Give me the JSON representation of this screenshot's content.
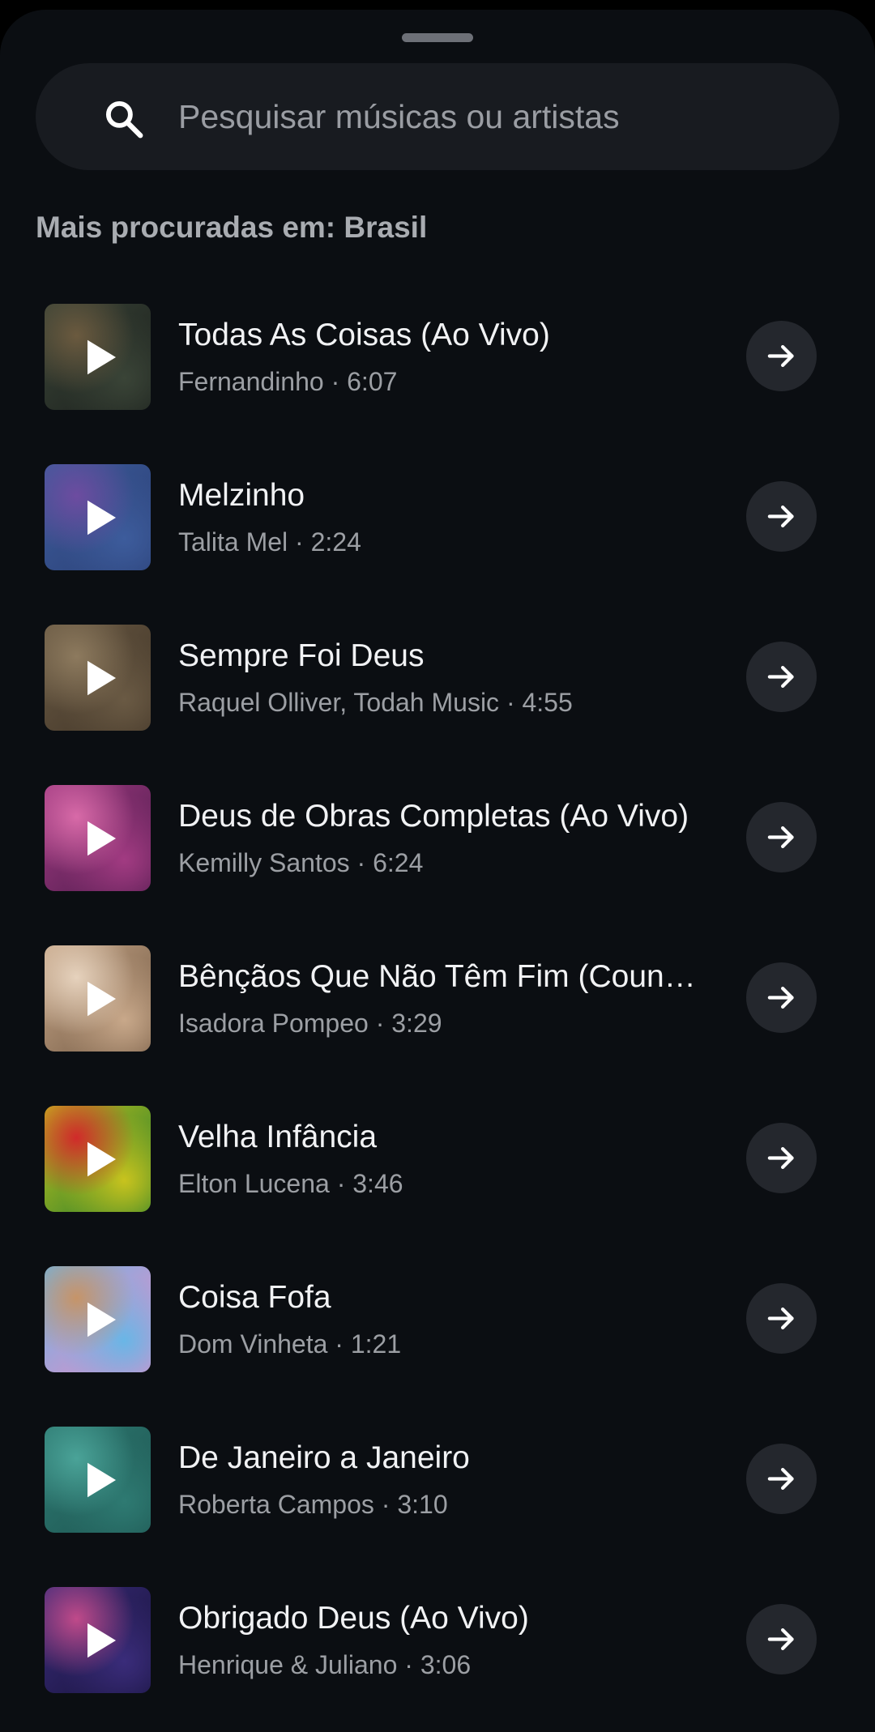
{
  "search": {
    "placeholder": "Pesquisar músicas ou artistas",
    "icon": "search-icon"
  },
  "section": {
    "title": "Mais procuradas em: Brasil"
  },
  "colors": {
    "background": "#0b0e12",
    "search_bg": "#181b20",
    "button_bg": "#24272d",
    "primary_text": "#f1f2f4",
    "secondary_text": "#9c9fa4"
  },
  "tracks": [
    {
      "title": "Todas As Coisas (Ao Vivo)",
      "subtitle": "Fernandinho · 6:07",
      "cover_colors": [
        "#3a4437",
        "#1a1f1c",
        "#6b5a3f"
      ],
      "play_icon": "play-icon",
      "action_icon": "arrow-right-icon"
    },
    {
      "title": "Melzinho",
      "subtitle": "Talita Mel · 2:24",
      "cover_colors": [
        "#3d5c9c",
        "#2a3f74",
        "#6d4ca0"
      ],
      "play_icon": "play-icon",
      "action_icon": "arrow-right-icon"
    },
    {
      "title": "Sempre Foi Deus",
      "subtitle": "Raquel Olliver, Todah Music · 4:55",
      "cover_colors": [
        "#6a5a44",
        "#3f3326",
        "#8d7a5e"
      ],
      "play_icon": "play-icon",
      "action_icon": "arrow-right-icon"
    },
    {
      "title": "Deus de Obras Completas (Ao Vivo)",
      "subtitle": "Kemilly Santos · 6:24",
      "cover_colors": [
        "#a23b82",
        "#4a1a4a",
        "#d86aa8"
      ],
      "play_icon": "play-icon",
      "action_icon": "arrow-right-icon"
    },
    {
      "title": "Bênçãos Que Não Têm Fim (Counting My Blessings)",
      "subtitle": "Isadora Pompeo · 3:29",
      "cover_colors": [
        "#c8a88a",
        "#6f5640",
        "#e6d2bd"
      ],
      "play_icon": "play-icon",
      "action_icon": "arrow-right-icon"
    },
    {
      "title": "Velha Infância",
      "subtitle": "Elton Lucena · 3:46",
      "cover_colors": [
        "#c8c31e",
        "#1c7a2c",
        "#d12a2a"
      ],
      "play_icon": "play-icon",
      "action_icon": "arrow-right-icon"
    },
    {
      "title": "Coisa Fofa",
      "subtitle": "Dom Vinheta · 1:21",
      "cover_colors": [
        "#69b6e6",
        "#e98bc6",
        "#c69468"
      ],
      "play_icon": "play-icon",
      "action_icon": "arrow-right-icon"
    },
    {
      "title": "De Janeiro a Janeiro",
      "subtitle": "Roberta Campos · 3:10",
      "cover_colors": [
        "#2e7a72",
        "#1d5450",
        "#4aa398"
      ],
      "play_icon": "play-icon",
      "action_icon": "arrow-right-icon"
    },
    {
      "title": "Obrigado Deus (Ao Vivo)",
      "subtitle": "Henrique & Juliano · 3:06",
      "cover_colors": [
        "#3a2c7a",
        "#16123a",
        "#c04a8a"
      ],
      "play_icon": "play-icon",
      "action_icon": "arrow-right-icon"
    }
  ]
}
